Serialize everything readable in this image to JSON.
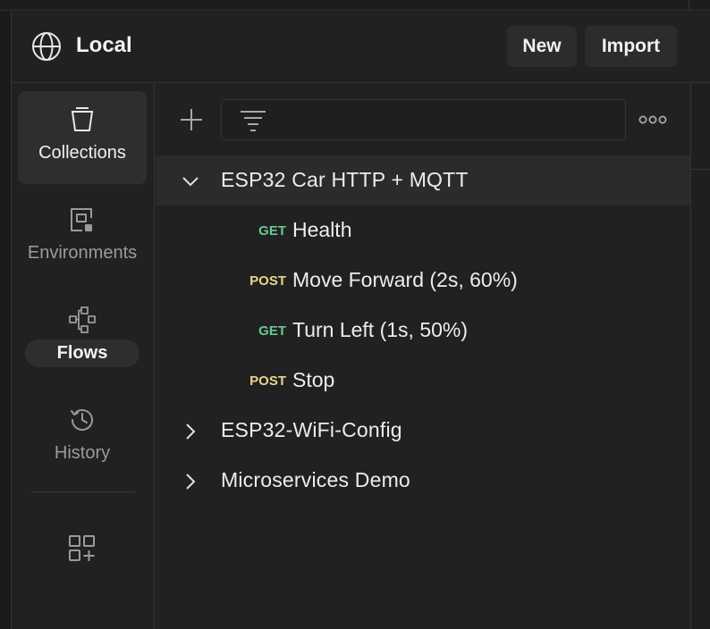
{
  "workspace": {
    "title": "Local"
  },
  "header": {
    "new_label": "New",
    "import_label": "Import"
  },
  "sidebar": {
    "items": [
      {
        "label": "Collections",
        "icon": "collections-icon",
        "selected": true
      },
      {
        "label": "Environments",
        "icon": "environments-icon"
      },
      {
        "label": "Flows",
        "icon": "flows-icon"
      },
      {
        "label": "History",
        "icon": "history-icon"
      }
    ],
    "apps_icon": "add-apps-icon"
  },
  "toolbar": {
    "add_icon": "plus-icon",
    "filter_icon": "filter-icon",
    "filter_value": "",
    "more_icon": "more-horizontal-icon"
  },
  "collections": [
    {
      "name": "ESP32 Car HTTP + MQTT",
      "expanded": true,
      "requests": [
        {
          "method": "GET",
          "name": "Health"
        },
        {
          "method": "POST",
          "name": "Move Forward (2s, 60%)"
        },
        {
          "method": "GET",
          "name": "Turn Left (1s, 50%)"
        },
        {
          "method": "POST",
          "name": "Stop"
        }
      ]
    },
    {
      "name": "ESP32-WiFi-Config",
      "expanded": false
    },
    {
      "name": "Microservices Demo",
      "expanded": false
    }
  ],
  "colors": {
    "get": "#6cc88f",
    "post": "#e8d68a",
    "background": "#212121",
    "selected": "#2e2e2e"
  }
}
